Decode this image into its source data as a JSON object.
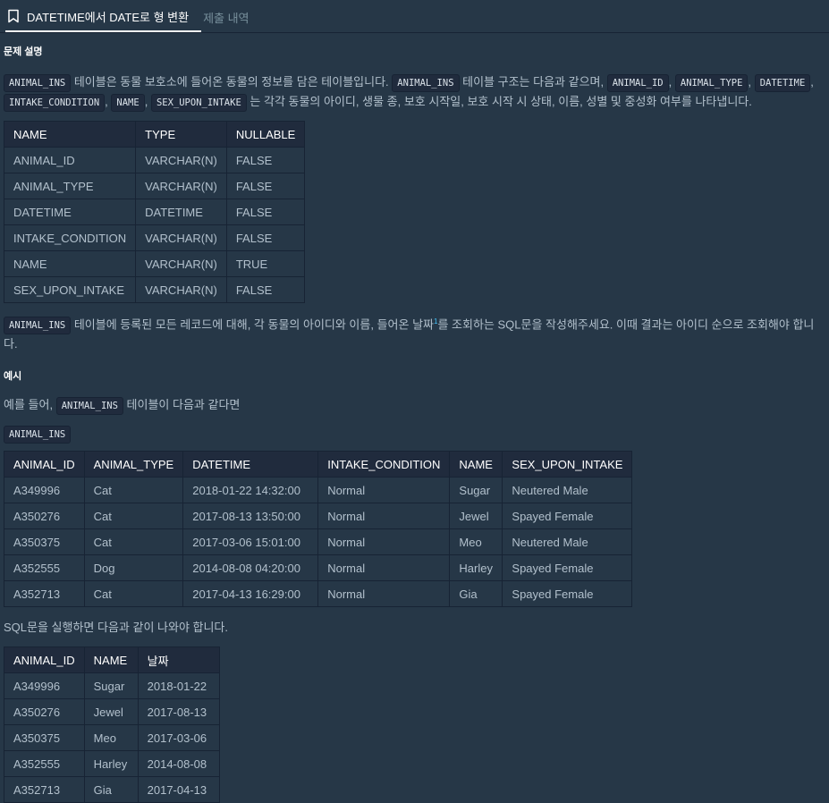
{
  "tabs": [
    {
      "label": "DATETIME에서 DATE로 형 변환",
      "active": true
    },
    {
      "label": "제출 내역",
      "active": false
    }
  ],
  "sections": {
    "description_title": "문제 설명",
    "example_title": "예시"
  },
  "desc": {
    "p1": {
      "c1": "ANIMAL_INS",
      "t1": "테이블은 동물 보호소에 들어온 동물의 정보를 담은 테이블입니다.",
      "c2": "ANIMAL_INS",
      "t2": "테이블 구조는 다음과 같으며,",
      "c3": "ANIMAL_ID",
      "c4": "ANIMAL_TYPE",
      "c5": "DATETIME",
      "c6": "INTAKE_CONDITION",
      "c7": "NAME",
      "c8": "SEX_UPON_INTAKE",
      "t3": "는 각각 동물의 아이디, 생물 종, 보호 시작일, 보호 시작 시 상태, 이름, 성별 및 중성화 여부를 나타냅니다.",
      "comma": ","
    },
    "p2": {
      "c1": "ANIMAL_INS",
      "t1": "테이블에 등록된 모든 레코드에 대해, 각 동물의 아이디와 이름, 들어온 날짜",
      "sup": "1",
      "t2": "를 조회하는 SQL문을 작성해주세요. 이때 결과는 아이디 순으로 조회해야 합니다."
    }
  },
  "schema_table": {
    "headers": [
      "NAME",
      "TYPE",
      "NULLABLE"
    ],
    "rows": [
      [
        "ANIMAL_ID",
        "VARCHAR(N)",
        "FALSE"
      ],
      [
        "ANIMAL_TYPE",
        "VARCHAR(N)",
        "FALSE"
      ],
      [
        "DATETIME",
        "DATETIME",
        "FALSE"
      ],
      [
        "INTAKE_CONDITION",
        "VARCHAR(N)",
        "FALSE"
      ],
      [
        "NAME",
        "VARCHAR(N)",
        "TRUE"
      ],
      [
        "SEX_UPON_INTAKE",
        "VARCHAR(N)",
        "FALSE"
      ]
    ]
  },
  "example": {
    "intro_t1": "예를 들어,",
    "intro_code": "ANIMAL_INS",
    "intro_t2": "테이블이 다음과 같다면",
    "table_label": "ANIMAL_INS",
    "result_text": "SQL문을 실행하면 다음과 같이 나와야 합니다."
  },
  "input_table": {
    "headers": [
      "ANIMAL_ID",
      "ANIMAL_TYPE",
      "DATETIME",
      "INTAKE_CONDITION",
      "NAME",
      "SEX_UPON_INTAKE"
    ],
    "rows": [
      [
        "A349996",
        "Cat",
        "2018-01-22 14:32:00",
        "Normal",
        "Sugar",
        "Neutered Male"
      ],
      [
        "A350276",
        "Cat",
        "2017-08-13 13:50:00",
        "Normal",
        "Jewel",
        "Spayed Female"
      ],
      [
        "A350375",
        "Cat",
        "2017-03-06 15:01:00",
        "Normal",
        "Meo",
        "Neutered Male"
      ],
      [
        "A352555",
        "Dog",
        "2014-08-08 04:20:00",
        "Normal",
        "Harley",
        "Spayed Female"
      ],
      [
        "A352713",
        "Cat",
        "2017-04-13 16:29:00",
        "Normal",
        "Gia",
        "Spayed Female"
      ]
    ]
  },
  "result_table": {
    "headers": [
      "ANIMAL_ID",
      "NAME",
      "날짜"
    ],
    "rows": [
      [
        "A349996",
        "Sugar",
        "2018-01-22"
      ],
      [
        "A350276",
        "Jewel",
        "2017-08-13"
      ],
      [
        "A350375",
        "Meo",
        "2017-03-06"
      ],
      [
        "A352555",
        "Harley",
        "2014-08-08"
      ],
      [
        "A352713",
        "Gia",
        "2017-04-13"
      ]
    ]
  },
  "colors": {
    "background": "#263747",
    "header_cell": "#202b3d",
    "border": "#172334",
    "text": "#b2c0cc",
    "accent": "#44c4fa"
  },
  "icons": {
    "bookmark": "bookmark-icon"
  }
}
